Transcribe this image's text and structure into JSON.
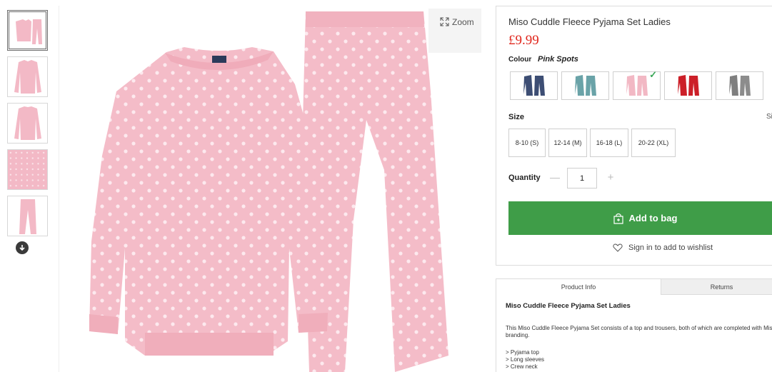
{
  "gallery": {
    "zoom_label": "Zoom"
  },
  "product": {
    "title": "Miso Cuddle Fleece Pyjama Set Ladies",
    "price": "£9.99",
    "colour_label": "Colour",
    "selected_colour": "Pink Spots",
    "swatches": [
      {
        "name": "navy",
        "color": "#3d4e74"
      },
      {
        "name": "teal",
        "color": "#6aa3a8"
      },
      {
        "name": "pink",
        "color": "#f2b8c4",
        "selected": true
      },
      {
        "name": "red",
        "color": "#cc1f28"
      },
      {
        "name": "grey",
        "color": "#7f7f7f"
      }
    ],
    "size_label": "Size",
    "size_guide_label": "Size Guide",
    "sizes": [
      "8-10 (S)",
      "12-14 (M)",
      "16-18 (L)",
      "20-22 (XL)"
    ],
    "quantity_label": "Quantity",
    "quantity": "1",
    "add_to_bag": "Add to bag",
    "wishlist": "Sign in to add to wishlist"
  },
  "info": {
    "tabs": [
      "Product Info",
      "Returns"
    ],
    "title": "Miso Cuddle Fleece Pyjama Set Ladies",
    "description": "This Miso Cuddle Fleece Pyjama Set consists of a top and trousers, both of which are completed with Miso branding.",
    "features": [
      "> Pyjama top",
      "> Long sleeves",
      "> Crew neck"
    ]
  },
  "colors": {
    "accent_green": "#3f9d48",
    "price_red": "#e0251b",
    "garment_pink": "#f3b9c6"
  }
}
